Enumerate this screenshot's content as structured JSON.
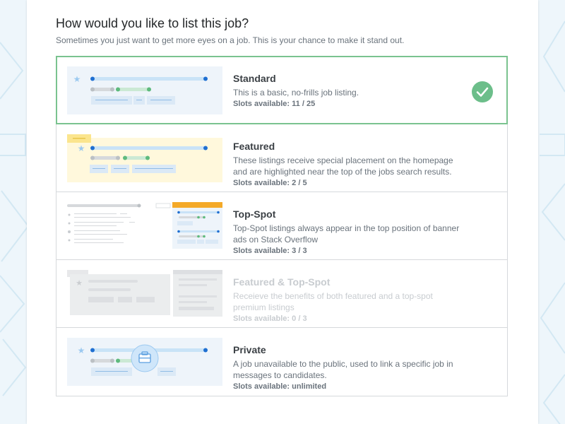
{
  "heading": {
    "title": "How would you like to list this job?",
    "subtitle": "Sometimes you just want to get more eyes on a job. This is your chance to make it stand out."
  },
  "slots_prefix": "Slots available: ",
  "colors": {
    "selected_border": "#7ac38f",
    "check": "#6cbe8a",
    "featured_bg": "#fff8dc",
    "topspot_bar": "#f4a928",
    "accent_blue": "#0a6fdc",
    "accent_green": "#5eba7d"
  },
  "options": [
    {
      "key": "standard",
      "name": "Standard",
      "description": "This is a basic, no-frills job listing.",
      "slots": "11 / 25",
      "selected": true,
      "enabled": true,
      "selected_icon": "checkmark-icon"
    },
    {
      "key": "featured",
      "name": "Featured",
      "description": "These listings receive special placement on the homepage and are highlighted near the top of the jobs search results.",
      "slots": "2 / 5",
      "selected": false,
      "enabled": true
    },
    {
      "key": "top-spot",
      "name": "Top-Spot",
      "description": "Top-Spot listings always appear in the top position of banner ads on Stack Overflow",
      "slots": "3 / 3",
      "selected": false,
      "enabled": true
    },
    {
      "key": "featured-top-spot",
      "name": "Featured & Top-Spot",
      "description": "Receieve the benefits of both featured and a top-spot premium listings",
      "slots": "0 / 3",
      "selected": false,
      "enabled": false
    },
    {
      "key": "private",
      "name": "Private",
      "description": "A job unavailable to the public, used to link a specific job in messages to candidates.",
      "slots": "unlimited",
      "selected": false,
      "enabled": true,
      "preview_icon": "briefcase-icon"
    }
  ]
}
